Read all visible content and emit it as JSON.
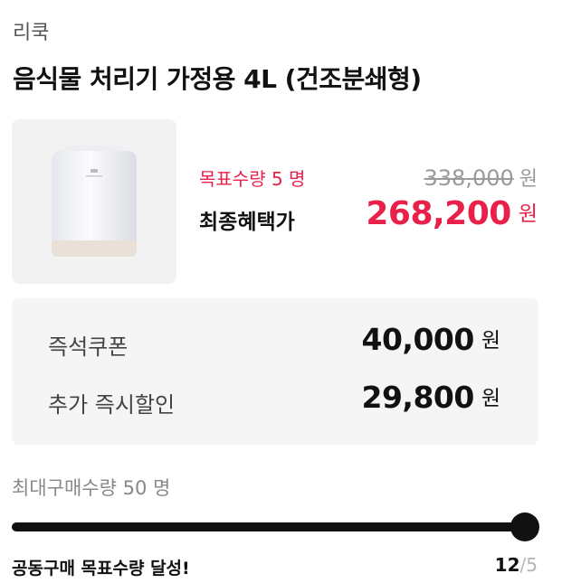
{
  "brand": "리쿡",
  "product": {
    "title": "음식물 처리기 가정용 4L (건조분쇄형)",
    "image_icon": "food-waste-processor-image"
  },
  "pricing": {
    "goal_label": "목표수량 5 명",
    "original_price": "338,000",
    "original_unit": "원",
    "final_label": "최종혜택가",
    "final_price": "268,200",
    "final_unit": "원"
  },
  "discounts": [
    {
      "label": "즉석쿠폰",
      "value": "40,000",
      "unit": "원"
    },
    {
      "label": "추가 즉시할인",
      "value": "29,800",
      "unit": "원"
    }
  ],
  "group_buy": {
    "max_label": "최대구매수량 50 명",
    "progress_fraction": 1.0,
    "achieved_label": "공동구매 목표수량 달성!",
    "current": "12",
    "separator": "/",
    "goal": "5"
  },
  "colors": {
    "accent": "#e8204a",
    "progress": "#111111",
    "muted": "#9a9a9a"
  }
}
